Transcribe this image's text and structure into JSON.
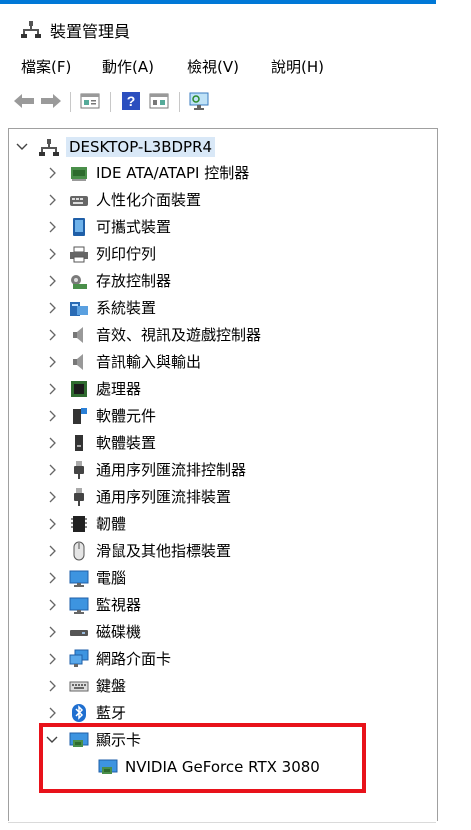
{
  "window": {
    "title": "裝置管理員"
  },
  "menu": [
    "檔案(F)",
    "動作(A)",
    "檢視(V)",
    "說明(H)"
  ],
  "toolbar": [
    "back-icon",
    "forward-icon",
    "properties-icon",
    "help-icon",
    "update-view-icon",
    "monitor-scan-icon"
  ],
  "tree": {
    "root": "DESKTOP-L3BDPR4",
    "categories": [
      "IDE ATA/ATAPI 控制器",
      "人性化介面裝置",
      "可攜式裝置",
      "列印佇列",
      "存放控制器",
      "系統裝置",
      "音效、視訊及遊戲控制器",
      "音訊輸入與輸出",
      "處理器",
      "軟體元件",
      "軟體裝置",
      "通用序列匯流排控制器",
      "通用序列匯流排裝置",
      "韌體",
      "滑鼠及其他指標裝置",
      "電腦",
      "監視器",
      "磁碟機",
      "網路介面卡",
      "鍵盤",
      "藍牙",
      "顯示卡"
    ],
    "display_child": "NVIDIA GeForce RTX 3080"
  },
  "colors": {
    "highlight_box": "#e8121a",
    "selection": "#d9e8f7"
  }
}
